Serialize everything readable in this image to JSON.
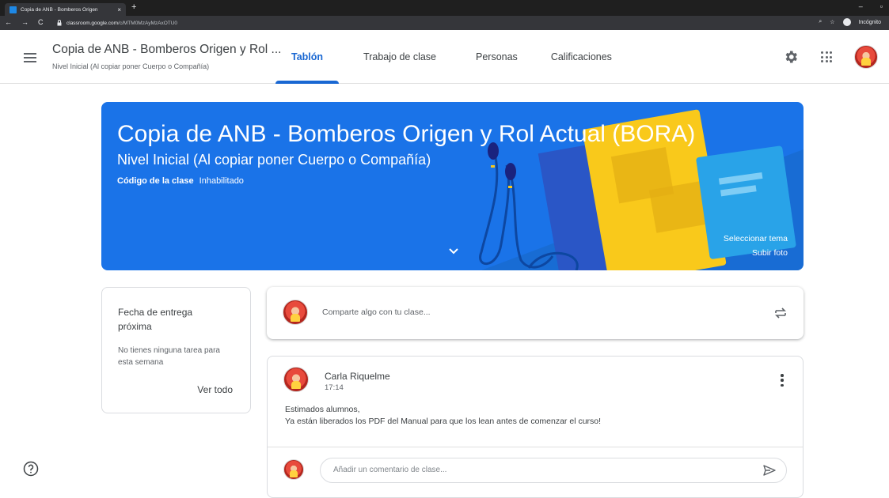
{
  "browser": {
    "tab_title": "Copia de ANB - Bomberos Origen",
    "tab_close": "×",
    "new_tab": "+",
    "url_host": "classroom.google.com",
    "url_path": "/c/MTM0MzAyMzAxOTU0",
    "incognito_label": "Incógnito",
    "window_min": "–",
    "window_max": "▫"
  },
  "header": {
    "course_title": "Copia de ANB - Bomberos Origen y Rol ...",
    "course_subtitle": "Nivel Inicial (Al copiar poner Cuerpo o Compañía)",
    "tabs": [
      {
        "label": "Tablón",
        "active": true
      },
      {
        "label": "Trabajo de clase",
        "active": false
      },
      {
        "label": "Personas",
        "active": false
      },
      {
        "label": "Calificaciones",
        "active": false
      }
    ]
  },
  "banner": {
    "title": "Copia de ANB - Bomberos Origen y Rol Actual (BORA)",
    "subtitle": "Nivel Inicial (Al copiar poner Cuerpo o Compañía)",
    "code_label": "Código de la clase",
    "code_value": "Inhabilitado",
    "select_theme": "Seleccionar tema",
    "upload_photo": "Subir foto",
    "color": "#1a73e8"
  },
  "upcoming": {
    "title": "Fecha de entrega próxima",
    "empty_text": "No tienes ninguna tarea para esta semana",
    "view_all": "Ver todo"
  },
  "share": {
    "placeholder": "Comparte algo con tu clase..."
  },
  "post": {
    "author": "Carla Riquelme",
    "time": "17:14",
    "line1": "Estimados alumnos,",
    "line2": "Ya están liberados los PDF del Manual para que los lean antes de comenzar el curso!",
    "comment_placeholder": "Añadir un comentario de clase..."
  },
  "colors": {
    "accent": "#1967d2",
    "text": "#3c4043",
    "muted": "#5f6368"
  }
}
